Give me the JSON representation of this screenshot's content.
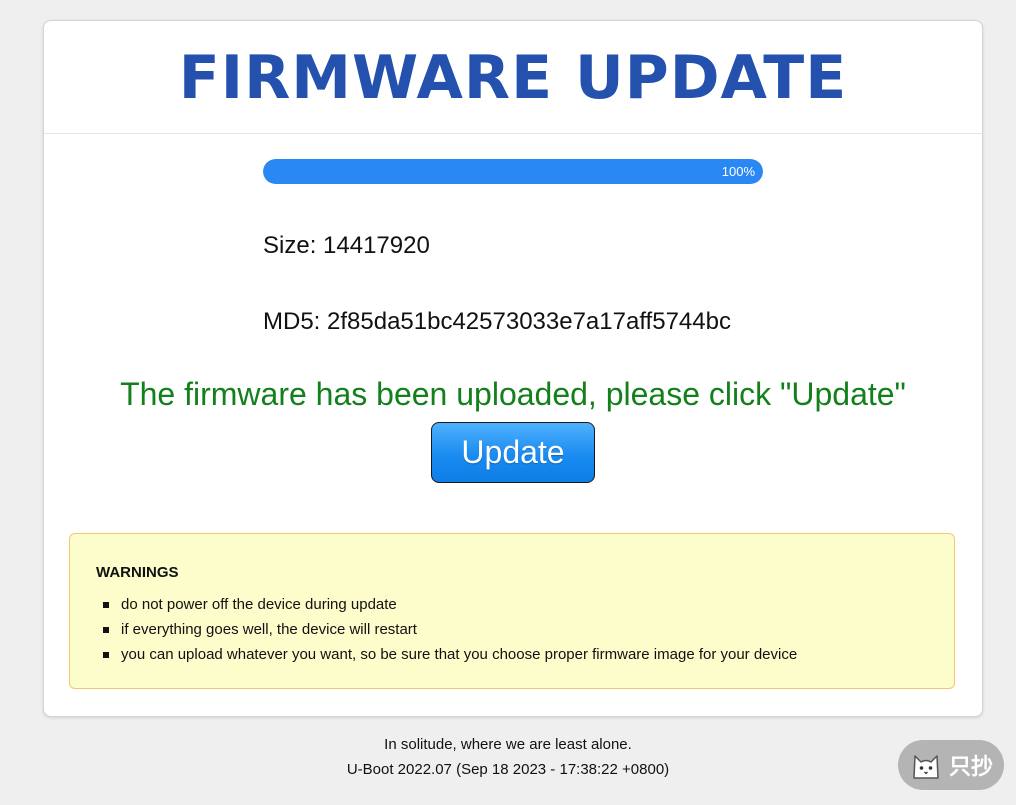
{
  "header": {
    "title": "FIRMWARE UPDATE"
  },
  "progress": {
    "percent": 100,
    "label": "100%"
  },
  "file_info": {
    "size_label": "Size: 14417920",
    "md5_label": "MD5: 2f85da51bc42573033e7a17aff5744bc"
  },
  "status": {
    "message": "The firmware has been uploaded, please click \"Update\""
  },
  "actions": {
    "update_label": "Update"
  },
  "warnings": {
    "title": "WARNINGS",
    "items": [
      "do not power off the device during update",
      "if everything goes well, the device will restart",
      "you can upload whatever you want, so be sure that you choose proper firmware image for your device"
    ]
  },
  "footer": {
    "tagline": "In solitude, where we are least alone.",
    "version": "U-Boot 2022.07 (Sep 18 2023 - 17:38:22 +0800)"
  },
  "badge": {
    "label": "只抄",
    "icon": "cat-icon"
  },
  "colors": {
    "title": "#2351ad",
    "progress_fill": "#2a88f5",
    "status_message": "#13801c",
    "warning_bg": "#fdfccb",
    "warning_border": "#f1c872"
  }
}
